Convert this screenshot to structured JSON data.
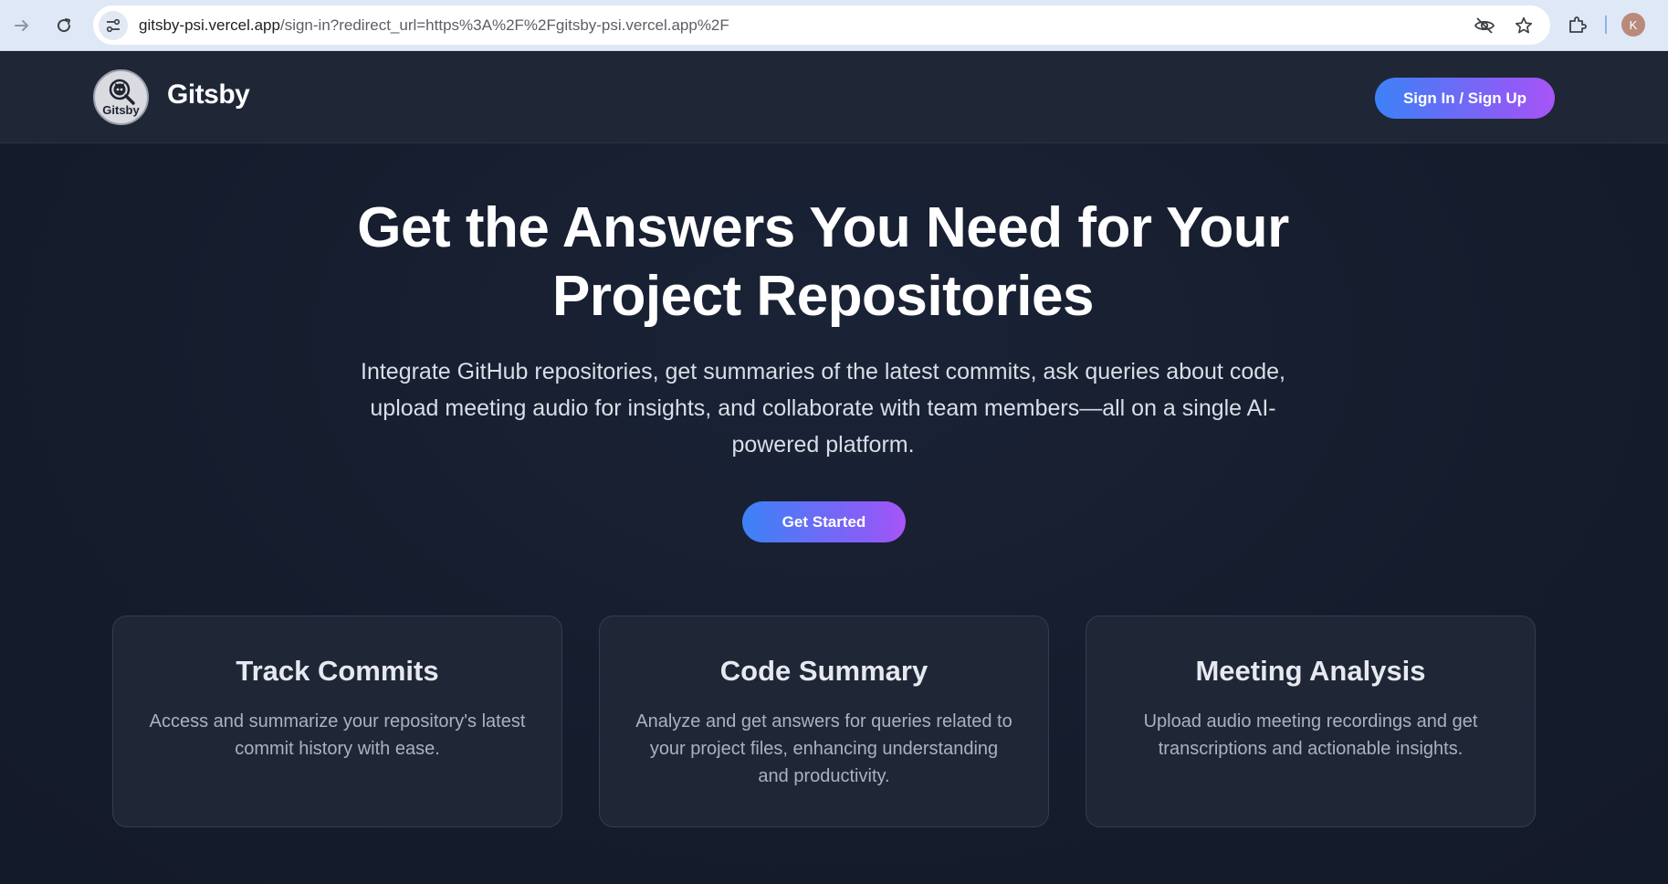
{
  "browser": {
    "url_host": "gitsby-psi.vercel.app",
    "url_path": "/sign-in?redirect_url=https%3A%2F%2Fgitsby-psi.vercel.app%2F",
    "profile_initial": "K"
  },
  "header": {
    "logo_text": "Gitsby",
    "brand_name": "Gitsby",
    "signin_label": "Sign In / Sign Up"
  },
  "hero": {
    "title_line1": "Get the Answers You Need for Your",
    "title_line2": "Project Repositories",
    "subtitle": "Integrate GitHub repositories, get summaries of the latest commits, ask queries about code, upload meeting audio for insights, and collaborate with team members—all on a single AI-powered platform.",
    "cta_label": "Get Started"
  },
  "features": [
    {
      "title": "Track Commits",
      "description": "Access and summarize your repository's latest commit history with ease."
    },
    {
      "title": "Code Summary",
      "description": "Analyze and get answers for queries related to your project files, enhancing understanding and productivity."
    },
    {
      "title": "Meeting Analysis",
      "description": "Upload audio meeting recordings and get transcriptions and actionable insights."
    }
  ],
  "colors": {
    "accent_start": "#3c82f6",
    "accent_end": "#a855f7",
    "page_bg": "#151b2b",
    "header_bg": "#1f2737",
    "card_bg": "#1f2737"
  }
}
